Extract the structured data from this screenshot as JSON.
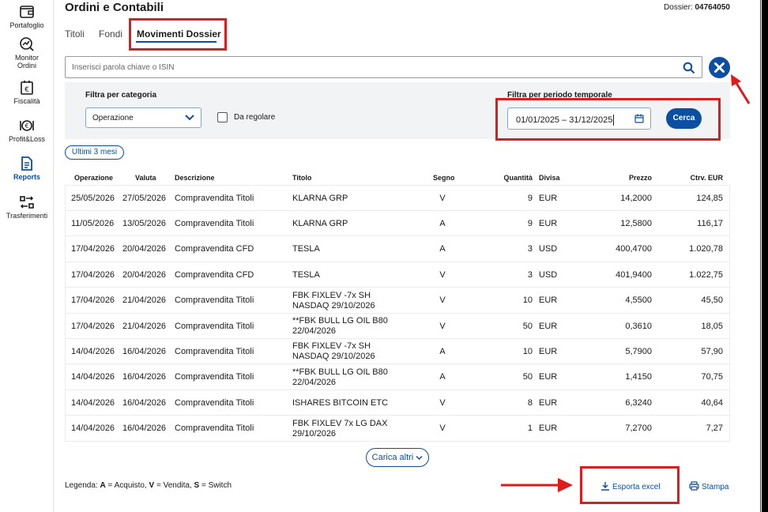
{
  "sidebar": {
    "items": [
      {
        "label": "Portafoglio",
        "icon": "wallet-icon"
      },
      {
        "label": "Monitor Ordini",
        "icon": "monitor-orders-icon"
      },
      {
        "label": "Fiscalità",
        "icon": "euro-document-icon"
      },
      {
        "label": "Profit&Loss",
        "icon": "profit-loss-icon"
      },
      {
        "label": "Reports",
        "icon": "report-document-icon",
        "active": true
      },
      {
        "label": "Trasferimenti",
        "icon": "transfer-icon"
      }
    ]
  },
  "header": {
    "title": "Ordini e Contabili",
    "dossier_label": "Dossier:",
    "dossier_number": "04764050"
  },
  "tabs": [
    {
      "label": "Titoli"
    },
    {
      "label": "Fondi"
    },
    {
      "label": "Movimenti Dossier",
      "active": true
    }
  ],
  "search": {
    "placeholder": "Inserisci parola chiave o ISIN"
  },
  "filters": {
    "category_label": "Filtra per categoria",
    "category_value": "Operazione",
    "da_regolare_label": "Da regolare",
    "period_label": "Filtra per periodo temporale",
    "period_value": "01/01/2025 – 31/12/2025",
    "search_button": "Cerca"
  },
  "chip": "Ultimi 3 mesi",
  "table": {
    "columns": [
      "Operazione",
      "Valuta",
      "Descrizione",
      "Titolo",
      "Segno",
      "Quantità",
      "Divisa",
      "Prezzo",
      "Ctrv. EUR"
    ],
    "rows": [
      [
        "25/05/2026",
        "27/05/2026",
        "Compravendita Titoli",
        "KLARNA GRP",
        "",
        "V",
        "9",
        "EUR",
        "14,2000",
        "124,85"
      ],
      [
        "11/05/2026",
        "13/05/2026",
        "Compravendita Titoli",
        "KLARNA GRP",
        "",
        "A",
        "9",
        "EUR",
        "12,5800",
        "116,17"
      ],
      [
        "17/04/2026",
        "20/04/2026",
        "Compravendita CFD",
        "TESLA",
        "",
        "A",
        "3",
        "USD",
        "400,4700",
        "1.020,78"
      ],
      [
        "17/04/2026",
        "20/04/2026",
        "Compravendita CFD",
        "TESLA",
        "",
        "V",
        "3",
        "USD",
        "401,9400",
        "1.022,75"
      ],
      [
        "17/04/2026",
        "21/04/2026",
        "Compravendita Titoli",
        "FBK FIXLEV -7x SH",
        "NASDAQ 29/10/2026",
        "V",
        "10",
        "EUR",
        "4,5500",
        "45,50"
      ],
      [
        "17/04/2026",
        "21/04/2026",
        "Compravendita Titoli",
        "**FBK BULL LG OIL B80",
        "22/04/2026",
        "V",
        "50",
        "EUR",
        "0,3610",
        "18,05"
      ],
      [
        "14/04/2026",
        "16/04/2026",
        "Compravendita Titoli",
        "FBK FIXLEV -7x SH",
        "NASDAQ 29/10/2026",
        "A",
        "10",
        "EUR",
        "5,7900",
        "57,90"
      ],
      [
        "14/04/2026",
        "16/04/2026",
        "Compravendita Titoli",
        "**FBK BULL LG OIL B80",
        "22/04/2026",
        "A",
        "50",
        "EUR",
        "1,4150",
        "70,75"
      ],
      [
        "14/04/2026",
        "16/04/2026",
        "Compravendita Titoli",
        "ISHARES BITCOIN ETC",
        "",
        "V",
        "8",
        "EUR",
        "6,3240",
        "40,64"
      ],
      [
        "14/04/2026",
        "16/04/2026",
        "Compravendita Titoli",
        "FBK FIXLEV 7x LG DAX",
        "29/10/2026",
        "V",
        "1",
        "EUR",
        "7,2700",
        "7,27"
      ]
    ]
  },
  "load_more": "Carica altri",
  "footer": {
    "legend_prefix": "Legenda:",
    "legend_a_key": "A",
    "legend_a": "= Acquisto,",
    "legend_v_key": "V",
    "legend_v": "= Vendita,",
    "legend_s_key": "S",
    "legend_s": "= Switch",
    "export_label": "Esporta excel",
    "print_label": "Stampa"
  },
  "colors": {
    "accent": "#0b4ea2",
    "highlight": "#e01b1b"
  }
}
